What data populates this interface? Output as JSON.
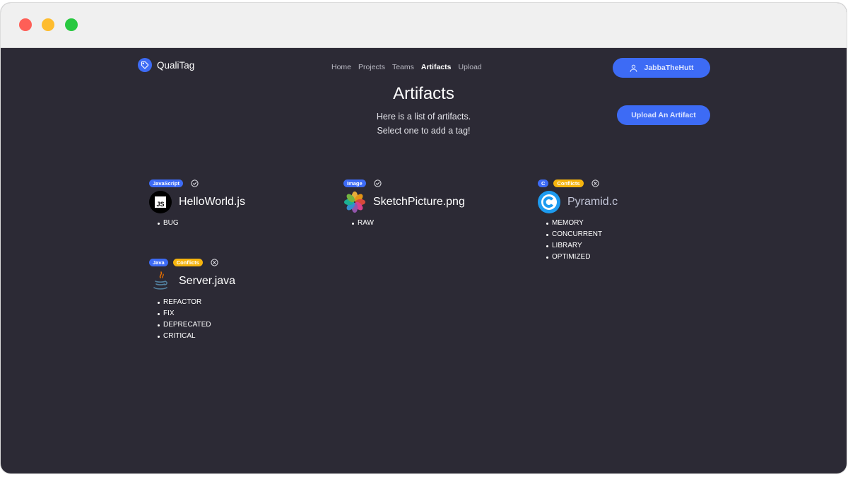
{
  "brand": {
    "name": "QualiTag"
  },
  "nav": {
    "items": [
      {
        "label": "Home",
        "active": false
      },
      {
        "label": "Projects",
        "active": false
      },
      {
        "label": "Teams",
        "active": false
      },
      {
        "label": "Artifacts",
        "active": true
      },
      {
        "label": "Upload",
        "active": false
      }
    ]
  },
  "user": {
    "name": "JabbaTheHutt"
  },
  "header": {
    "title": "Artifacts",
    "subtitle_line1": "Here is a list of artifacts.",
    "subtitle_line2": "Select one to add a tag!",
    "upload_button": "Upload An Artifact"
  },
  "artifacts": [
    {
      "language": "JavaScript",
      "conflict_label": "",
      "status": "check-circle-icon",
      "file_icon": "javascript-icon",
      "name": "HelloWorld.js",
      "tags": [
        "BUG"
      ]
    },
    {
      "language": "Image",
      "conflict_label": "",
      "status": "check-circle-icon",
      "file_icon": "photos-flower-icon",
      "name": "SketchPicture.png",
      "tags": [
        "RAW"
      ]
    },
    {
      "language": "C",
      "conflict_label": "Conflicts",
      "status": "x-circle-icon",
      "file_icon": "c-language-icon",
      "name": "Pyramid.c",
      "tags": [
        "MEMORY",
        "CONCURRENT",
        "LIBRARY",
        "OPTIMIZED"
      ]
    },
    {
      "language": "Java",
      "conflict_label": "Conflicts",
      "status": "x-circle-icon",
      "file_icon": "java-icon",
      "name": "Server.java",
      "tags": [
        "REFACTOR",
        "FIX",
        "DEPRECATED",
        "CRITICAL"
      ]
    }
  ],
  "colors": {
    "background": "#2c2a35",
    "accent": "#3d6bf5",
    "conflict": "#f5b40e"
  }
}
